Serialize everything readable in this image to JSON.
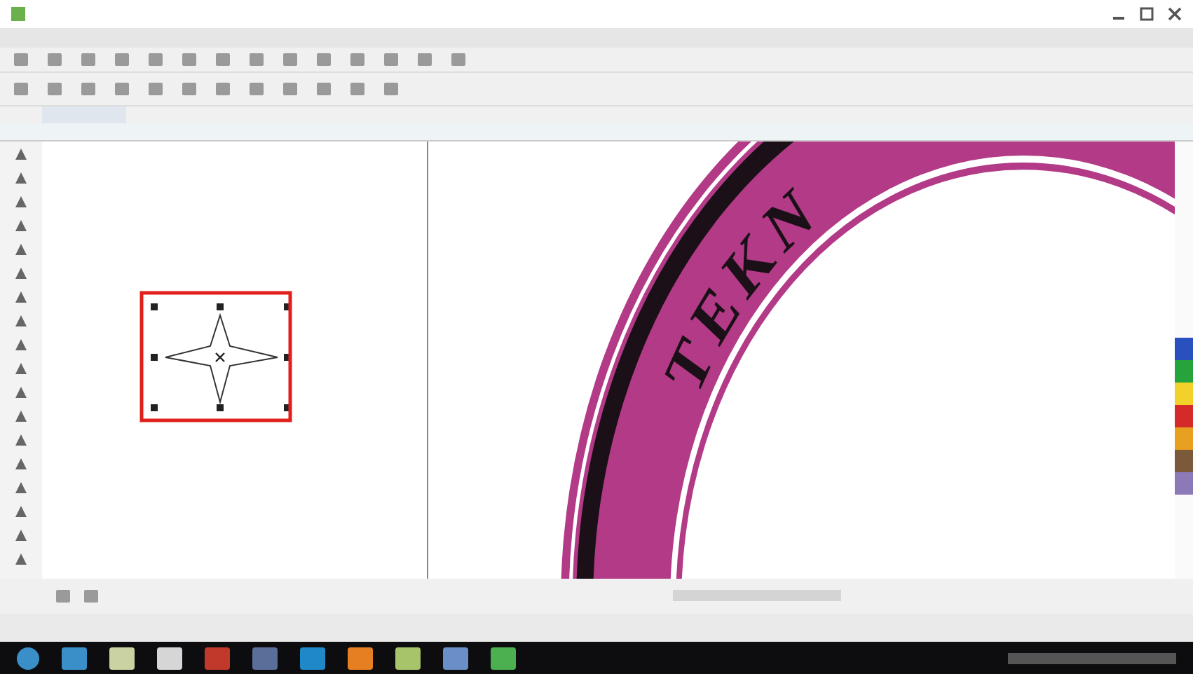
{
  "canvas": {
    "stamp_text": "TEKN",
    "star": {
      "selected": true
    }
  },
  "annotation": {
    "kind": "highlight-box"
  }
}
